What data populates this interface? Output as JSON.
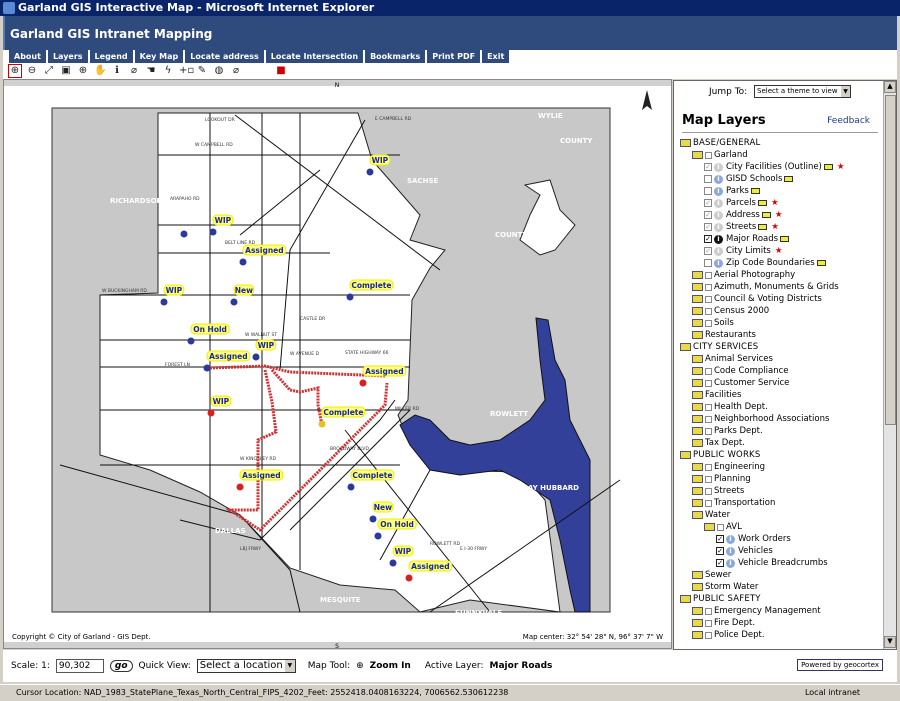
{
  "window_title": "Garland GIS Interactive Map - Microsoft Internet Explorer",
  "app_title": "Garland GIS Intranet Mapping",
  "tabs": [
    "About",
    "Layers",
    "Legend",
    "Key Map",
    "Locate address",
    "Locate Intersection",
    "Bookmarks",
    "Print PDF",
    "Exit"
  ],
  "tools": [
    {
      "icon": "zoom-in-icon",
      "glyph": "⊕",
      "selected": true
    },
    {
      "icon": "zoom-out-icon",
      "glyph": "⊖"
    },
    {
      "icon": "full-extent-icon",
      "glyph": "⤢"
    },
    {
      "icon": "zoom-previous-icon",
      "glyph": "▣"
    },
    {
      "icon": "zoom-selection-icon",
      "glyph": "⊕"
    },
    {
      "icon": "pan-hand-icon",
      "glyph": "✋"
    },
    {
      "icon": "identify-icon",
      "glyph": "ℹ"
    },
    {
      "icon": "eraser-icon",
      "glyph": "⌀"
    },
    {
      "icon": "select-icon",
      "glyph": "☚"
    },
    {
      "icon": "lightning-icon",
      "glyph": "ϟ"
    },
    {
      "icon": "add-point-icon",
      "glyph": "+▫"
    },
    {
      "icon": "markup-icon",
      "glyph": "✎"
    },
    {
      "icon": "buffer-icon",
      "glyph": "◍"
    },
    {
      "icon": "clear-icon",
      "glyph": "⌀"
    },
    {
      "icon": "print-icon",
      "glyph": "■"
    }
  ],
  "map": {
    "copyright": "Copyright © City of Garland - GIS Dept.",
    "center": "Map center: 32° 54' 28\" N, 96° 37' 7\" W",
    "north_label": "N",
    "south_label": "S",
    "places": [
      "RICHARDSON",
      "SACHSE",
      "WYLIE",
      "COUNTY",
      "COUNTY",
      "ROWLETT",
      "LAKE RAY HUBBARD",
      "DALLAS",
      "MESQUITE",
      "SUNNYVALE"
    ],
    "roads": [
      "LOOKOUT DR",
      "E CAMPBELL RD",
      "W CAMPBELL RD",
      "ARAPAHO RD",
      "BELT LINE RD",
      "W BUCKINGHAM RD",
      "CASTLE DR",
      "W WALNUT ST",
      "FOREST LN",
      "W AVENUE D",
      "STATE HIGHWAY 66",
      "MILLER RD",
      "W KINGSLEY RD",
      "LBJ FRWY",
      "BROADWAY BLVD",
      "ROWLETT RD",
      "E I-30 FRWY"
    ],
    "colors": {
      "land": "#c8c8c8",
      "city": "#ffffff",
      "water": "#33409a",
      "breadcrumb": "#d03030",
      "blue_marker": "#2a3a9a",
      "red_marker": "#d82020",
      "yellow_marker": "#e8c020",
      "label_bg": "#ffff80"
    },
    "work_orders": [
      {
        "status": "WIP",
        "color": "blue"
      },
      {
        "status": "",
        "color": "blue"
      },
      {
        "status": "WIP",
        "color": "blue"
      },
      {
        "status": "Assigned",
        "color": "blue"
      },
      {
        "status": "WIP",
        "color": "blue"
      },
      {
        "status": "New",
        "color": "blue"
      },
      {
        "status": "Complete",
        "color": "blue"
      },
      {
        "status": "On Hold",
        "color": "blue"
      },
      {
        "status": "Assigned",
        "color": "blue"
      },
      {
        "status": "WIP",
        "color": "blue"
      },
      {
        "status": "Assigned",
        "color": "red"
      },
      {
        "status": "WIP",
        "color": "red"
      },
      {
        "status": "Complete",
        "color": "yellow"
      },
      {
        "status": "Assigned",
        "color": "red"
      },
      {
        "status": "Complete",
        "color": "blue"
      },
      {
        "status": "New",
        "color": "blue"
      },
      {
        "status": "On Hold",
        "color": "blue"
      },
      {
        "status": "WIP",
        "color": "blue"
      },
      {
        "status": "Assigned",
        "color": "red"
      }
    ]
  },
  "panel": {
    "jump_label": "Jump To:",
    "jump_value": "Select a theme to view",
    "title": "Map Layers",
    "feedback": "Feedback",
    "tree": [
      {
        "label": "BASE/GENERAL",
        "level": 0,
        "folder": true
      },
      {
        "label": "Garland",
        "level": 1,
        "folder": true,
        "check": "off"
      },
      {
        "label": "City Facilities (Outline)",
        "level": 2,
        "check": "dim",
        "info": "dim",
        "tag": true,
        "star": true
      },
      {
        "label": "GISD Schools",
        "level": 2,
        "check": "open",
        "info": "blue",
        "tag": true
      },
      {
        "label": "Parks",
        "level": 2,
        "check": "open",
        "info": "blue",
        "tag": true
      },
      {
        "label": "Parcels",
        "level": 2,
        "check": "dim",
        "info": "dim",
        "tag": true,
        "star": true
      },
      {
        "label": "Address",
        "level": 2,
        "check": "dim",
        "info": "dim",
        "tag": true,
        "star": true
      },
      {
        "label": "Streets",
        "level": 2,
        "check": "dim",
        "info": "dim",
        "tag": true,
        "star": true
      },
      {
        "label": "Major Roads",
        "level": 2,
        "check": "on",
        "info": "black",
        "tag": true
      },
      {
        "label": "City Limits",
        "level": 2,
        "check": "dim",
        "info": "dim",
        "star": true
      },
      {
        "label": "Zip Code Boundaries",
        "level": 2,
        "check": "open",
        "info": "blue",
        "tag": true
      },
      {
        "label": "Aerial Photography",
        "level": 1,
        "folder": true,
        "check": "off"
      },
      {
        "label": "Azimuth, Monuments & Grids",
        "level": 1,
        "folder": true,
        "check": "off"
      },
      {
        "label": "Council & Voting Districts",
        "level": 1,
        "folder": true,
        "check": "off"
      },
      {
        "label": "Census 2000",
        "level": 1,
        "folder": true,
        "check": "off"
      },
      {
        "label": "Soils",
        "level": 1,
        "folder": true,
        "check": "off"
      },
      {
        "label": "Restaurants",
        "level": 1,
        "folder": true
      },
      {
        "label": "CITY SERVICES",
        "level": 0,
        "folder": true
      },
      {
        "label": "Animal Services",
        "level": 1,
        "folder": true
      },
      {
        "label": "Code Compliance",
        "level": 1,
        "folder": true,
        "check": "off"
      },
      {
        "label": "Customer Service",
        "level": 1,
        "folder": true,
        "check": "off"
      },
      {
        "label": "Facilities",
        "level": 1,
        "folder": true
      },
      {
        "label": "Health Dept.",
        "level": 1,
        "folder": true,
        "check": "off"
      },
      {
        "label": "Neighborhood Associations",
        "level": 1,
        "folder": true,
        "check": "off"
      },
      {
        "label": "Parks Dept.",
        "level": 1,
        "folder": true,
        "check": "off"
      },
      {
        "label": "Tax Dept.",
        "level": 1,
        "folder": true
      },
      {
        "label": "PUBLIC WORKS",
        "level": 0,
        "folder": true
      },
      {
        "label": "Engineering",
        "level": 1,
        "folder": true,
        "check": "off"
      },
      {
        "label": "Planning",
        "level": 1,
        "folder": true,
        "check": "off"
      },
      {
        "label": "Streets",
        "level": 1,
        "folder": true,
        "check": "off"
      },
      {
        "label": "Transportation",
        "level": 1,
        "folder": true,
        "check": "off"
      },
      {
        "label": "Water",
        "level": 1,
        "folder": true
      },
      {
        "label": "AVL",
        "level": 2,
        "folder": true,
        "check": "off"
      },
      {
        "label": "Work Orders",
        "level": 3,
        "check": "on",
        "info": "blue"
      },
      {
        "label": "Vehicles",
        "level": 3,
        "check": "on",
        "info": "blue"
      },
      {
        "label": "Vehicle Breadcrumbs",
        "level": 3,
        "check": "on",
        "info": "blue"
      },
      {
        "label": "Sewer",
        "level": 1,
        "folder": true
      },
      {
        "label": "Storm Water",
        "level": 1,
        "folder": true
      },
      {
        "label": "PUBLIC SAFETY",
        "level": 0,
        "folder": true
      },
      {
        "label": "Emergency Management",
        "level": 1,
        "folder": true,
        "check": "off"
      },
      {
        "label": "Fire Dept.",
        "level": 1,
        "folder": true,
        "check": "off"
      },
      {
        "label": "Police Dept.",
        "level": 1,
        "folder": true,
        "check": "off"
      }
    ]
  },
  "bottom": {
    "scale_label": "Scale: 1:",
    "scale_value": "90,302",
    "go_label": "go",
    "quick_view_label": "Quick View:",
    "quick_view_value": "Select a location",
    "map_tool_label": "Map Tool:",
    "map_tool_value": "Zoom In",
    "active_layer_label": "Active Layer:",
    "active_layer_value": "Major Roads",
    "powered_by": "Powered by geocortex"
  },
  "status": {
    "cursor": "Cursor Location: NAD_1983_StatePlane_Texas_North_Central_FIPS_4202_Feet: 2552418.0408163224, 7006562.530612238",
    "zone": "Local intranet"
  }
}
